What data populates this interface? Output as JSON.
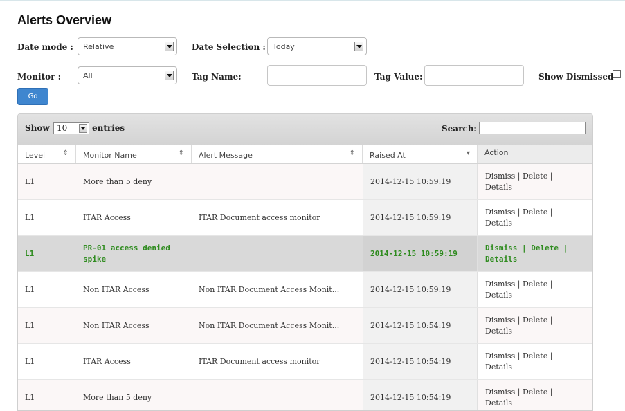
{
  "page": {
    "title": "Alerts Overview"
  },
  "filters": {
    "date_mode_label": "Date mode :",
    "date_mode_value": "Relative",
    "date_selection_label": "Date Selection :",
    "date_selection_value": "Today",
    "monitor_label": "Monitor :",
    "monitor_value": "All",
    "tag_name_label": "Tag Name:",
    "tag_name_value": "",
    "tag_value_label": "Tag Value:",
    "tag_value_value": "",
    "show_dismissed_label": "Show Dismissed",
    "show_dismissed_checked": false,
    "go_label": "Go"
  },
  "table": {
    "show_label": "Show",
    "entries_count": "10",
    "entries_label": "entries",
    "search_label": "Search:",
    "search_value": "",
    "columns": [
      {
        "label": "Level",
        "sort": "⇕"
      },
      {
        "label": "Monitor Name",
        "sort": "⇕"
      },
      {
        "label": "Alert Message",
        "sort": "⇕"
      },
      {
        "label": "Raised At",
        "sort": "▾"
      },
      {
        "label": "Action",
        "sort": ""
      }
    ],
    "action_dismiss": "Dismiss",
    "action_delete": "Delete",
    "action_details": "Details",
    "action_sep": " | ",
    "rows": [
      {
        "level": "L1",
        "monitor": "More than 5 deny",
        "message": "",
        "raised": "2014-12-15 10:59:19",
        "style": "alt"
      },
      {
        "level": "L1",
        "monitor": "ITAR Access",
        "message": "ITAR Document access monitor",
        "raised": "2014-12-15 10:59:19",
        "style": ""
      },
      {
        "level": "L1",
        "monitor": "PR-01 access denied spike",
        "message": "",
        "raised": "2014-12-15 10:59:19",
        "style": "sel"
      },
      {
        "level": "L1",
        "monitor": "Non ITAR Access",
        "message": "Non ITAR Document Access Monit...",
        "raised": "2014-12-15 10:59:19",
        "style": ""
      },
      {
        "level": "L1",
        "monitor": "Non ITAR Access",
        "message": "Non ITAR Document Access Monit...",
        "raised": "2014-12-15 10:54:19",
        "style": "alt"
      },
      {
        "level": "L1",
        "monitor": "ITAR Access",
        "message": "ITAR Document access monitor",
        "raised": "2014-12-15 10:54:19",
        "style": ""
      },
      {
        "level": "L1",
        "monitor": "More than 5 deny",
        "message": "",
        "raised": "2014-12-15 10:54:19",
        "style": "alt"
      }
    ]
  }
}
